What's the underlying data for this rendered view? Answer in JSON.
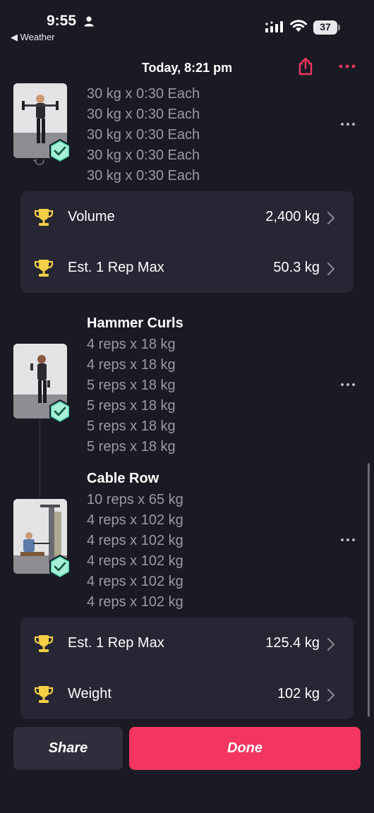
{
  "status_bar": {
    "time": "9:55",
    "back_app": "◀ Weather",
    "battery": "37",
    "icons": [
      "person-icon",
      "signal-icon",
      "wifi-icon",
      "battery-icon"
    ]
  },
  "header": {
    "title": "Today, 8:21 pm",
    "icons": [
      "share-icon",
      "more-icon"
    ]
  },
  "colors": {
    "background": "#1a1a24",
    "card": "#262634",
    "accent": "#f2365f",
    "trophy": "#f5cf45",
    "check": "#6ee0c0",
    "secondary_text": "#9a9aa3"
  },
  "exercise1": {
    "sets": [
      "30 kg x 0:30 Each",
      "30 kg x 0:30 Each",
      "30 kg x 0:30 Each",
      "30 kg x 0:30 Each",
      "30 kg x 0:30 Each"
    ],
    "records": [
      {
        "label": "Volume",
        "value": "2,400 kg"
      },
      {
        "label": "Est. 1 Rep Max",
        "value": "50.3 kg"
      }
    ]
  },
  "exercise2": {
    "name": "Hammer Curls",
    "sets": [
      "4 reps x 18 kg",
      "4 reps x 18 kg",
      "5 reps x 18 kg",
      "5 reps x 18 kg",
      "5 reps x 18 kg",
      "5 reps x 18 kg"
    ]
  },
  "exercise3": {
    "name": "Cable Row",
    "sets": [
      "10 reps x 65 kg",
      "4 reps x 102 kg",
      "4 reps x 102 kg",
      "4 reps x 102 kg",
      "4 reps x 102 kg",
      "4 reps x 102 kg"
    ]
  },
  "records2": [
    {
      "label": "Est. 1 Rep Max",
      "value": "125.4 kg"
    },
    {
      "label": "Weight",
      "value": "102 kg"
    }
  ],
  "buttons": {
    "share": "Share",
    "done": "Done"
  }
}
